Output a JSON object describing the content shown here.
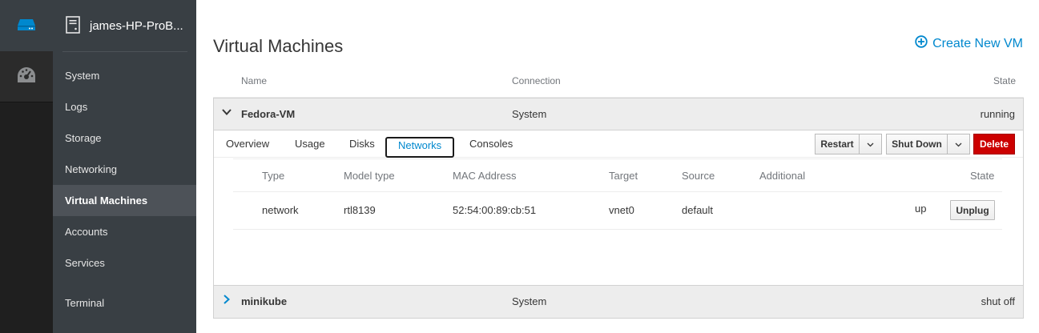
{
  "rail": {
    "host_icon": "server-icon",
    "dashboard_icon": "dashboard-icon"
  },
  "host": {
    "name": "james-HP-ProB...",
    "icon": "server-icon"
  },
  "nav": {
    "items": [
      {
        "label": "System"
      },
      {
        "label": "Logs"
      },
      {
        "label": "Storage"
      },
      {
        "label": "Networking"
      },
      {
        "label": "Virtual Machines",
        "active": true
      },
      {
        "label": "Accounts"
      },
      {
        "label": "Services"
      },
      {
        "label": "Terminal"
      }
    ]
  },
  "page": {
    "title": "Virtual Machines",
    "create_label": "Create New VM"
  },
  "vm_list": {
    "columns": {
      "name": "Name",
      "connection": "Connection",
      "state": "State"
    },
    "vms": [
      {
        "name": "Fedora-VM",
        "connection": "System",
        "state": "running",
        "expanded": true
      },
      {
        "name": "minikube",
        "connection": "System",
        "state": "shut off",
        "expanded": false
      }
    ]
  },
  "vm_detail": {
    "tabs": [
      "Overview",
      "Usage",
      "Disks",
      "Networks",
      "Consoles"
    ],
    "active_tab": "Networks",
    "actions": {
      "restart": "Restart",
      "shutdown": "Shut Down",
      "delete": "Delete"
    },
    "networks": {
      "columns": [
        "Type",
        "Model type",
        "MAC Address",
        "Target",
        "Source",
        "Additional",
        "State"
      ],
      "rows": [
        {
          "type": "network",
          "model": "rtl8139",
          "mac": "52:54:00:89:cb:51",
          "target": "vnet0",
          "source": "default",
          "additional": "",
          "state": "up",
          "action": "Unplug"
        }
      ]
    }
  },
  "colors": {
    "accent": "#0088ce",
    "danger": "#cc0000",
    "nav_bg": "#393f44"
  }
}
